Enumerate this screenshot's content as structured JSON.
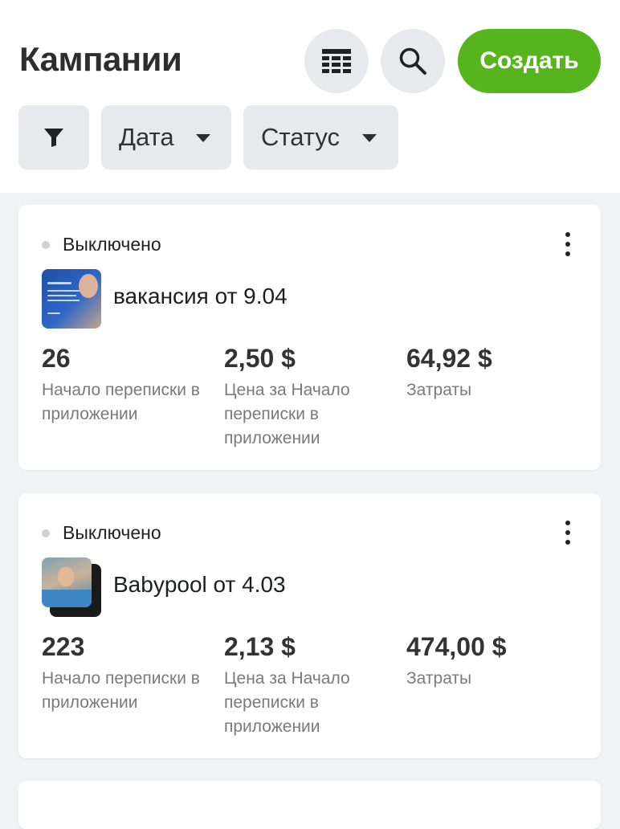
{
  "header": {
    "title": "Кампании",
    "create_label": "Создать",
    "accent_color": "#56b51c"
  },
  "filters": {
    "date_label": "Дата",
    "status_label": "Статус"
  },
  "campaigns": [
    {
      "status": "Выключено",
      "name": "вакансия от 9.04",
      "metrics": [
        {
          "value": "26",
          "label": "Начало переписки в приложении"
        },
        {
          "value": "2,50 $",
          "label": "Цена за Начало переписки в приложении"
        },
        {
          "value": "64,92 $",
          "label": "Затраты"
        }
      ]
    },
    {
      "status": "Выключено",
      "name": "Babypool от 4.03",
      "metrics": [
        {
          "value": "223",
          "label": "Начало переписки в приложении"
        },
        {
          "value": "2,13 $",
          "label": "Цена за Начало переписки в приложении"
        },
        {
          "value": "474,00 $",
          "label": "Затраты"
        }
      ]
    }
  ],
  "icons": {
    "table": "table-view-icon",
    "search": "search-icon",
    "filter": "filter-icon",
    "more": "more-vertical-icon"
  }
}
